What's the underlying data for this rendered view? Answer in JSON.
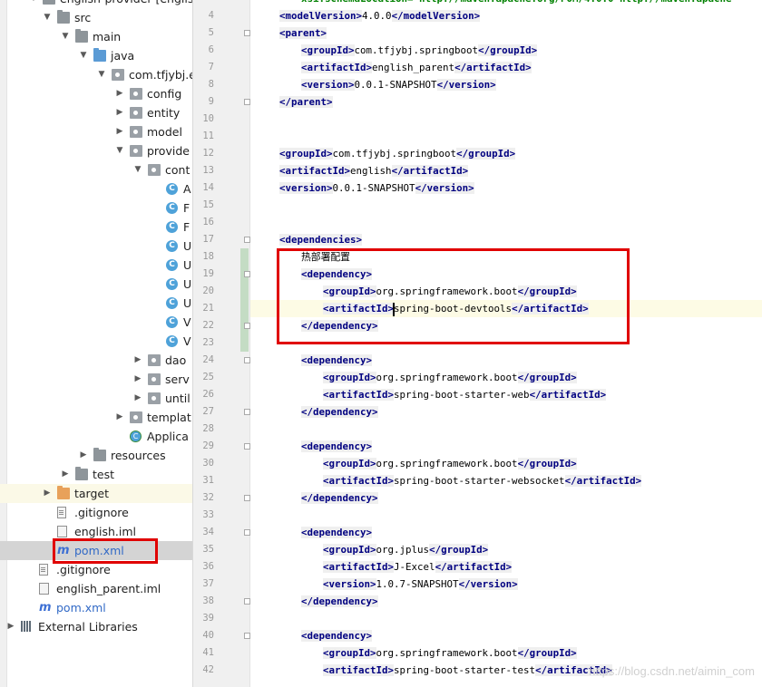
{
  "tree": {
    "project_label": "english-provider [english",
    "items": [
      {
        "label": "src",
        "depth": 1,
        "arrow": "down",
        "icon": "folder-gray"
      },
      {
        "label": "main",
        "depth": 2,
        "arrow": "down",
        "icon": "folder-gray"
      },
      {
        "label": "java",
        "depth": 3,
        "arrow": "down",
        "icon": "folder-blue"
      },
      {
        "label": "com.tfjybj.e",
        "depth": 4,
        "arrow": "down",
        "icon": "package"
      },
      {
        "label": "config",
        "depth": 5,
        "arrow": "right",
        "icon": "package"
      },
      {
        "label": "entity",
        "depth": 5,
        "arrow": "right",
        "icon": "package"
      },
      {
        "label": "model",
        "depth": 5,
        "arrow": "right",
        "icon": "package"
      },
      {
        "label": "provide",
        "depth": 5,
        "arrow": "down",
        "icon": "package"
      },
      {
        "label": "cont",
        "depth": 6,
        "arrow": "down",
        "icon": "package"
      },
      {
        "label": "A",
        "depth": 7,
        "arrow": "",
        "icon": "class"
      },
      {
        "label": "F",
        "depth": 7,
        "arrow": "",
        "icon": "class"
      },
      {
        "label": "F",
        "depth": 7,
        "arrow": "",
        "icon": "class"
      },
      {
        "label": "U",
        "depth": 7,
        "arrow": "",
        "icon": "class"
      },
      {
        "label": "U",
        "depth": 7,
        "arrow": "",
        "icon": "class"
      },
      {
        "label": "U",
        "depth": 7,
        "arrow": "",
        "icon": "class"
      },
      {
        "label": "U",
        "depth": 7,
        "arrow": "",
        "icon": "class"
      },
      {
        "label": "V",
        "depth": 7,
        "arrow": "",
        "icon": "class"
      },
      {
        "label": "V",
        "depth": 7,
        "arrow": "",
        "icon": "class"
      },
      {
        "label": "dao",
        "depth": 6,
        "arrow": "right",
        "icon": "package"
      },
      {
        "label": "serv",
        "depth": 6,
        "arrow": "right",
        "icon": "package"
      },
      {
        "label": "until",
        "depth": 6,
        "arrow": "right",
        "icon": "package"
      },
      {
        "label": "templat",
        "depth": 5,
        "arrow": "right",
        "icon": "package"
      },
      {
        "label": "Applica",
        "depth": 5,
        "arrow": "",
        "icon": "app"
      },
      {
        "label": "resources",
        "depth": 3,
        "arrow": "right",
        "icon": "folder-res"
      },
      {
        "label": "test",
        "depth": 2,
        "arrow": "right",
        "icon": "folder-gray"
      },
      {
        "label": "target",
        "depth": 1,
        "arrow": "right",
        "icon": "folder-orange"
      },
      {
        "label": ".gitignore",
        "depth": 1,
        "arrow": "",
        "icon": "file"
      },
      {
        "label": "english.iml",
        "depth": 1,
        "arrow": "",
        "icon": "iml"
      },
      {
        "label": "pom.xml",
        "depth": 1,
        "arrow": "",
        "icon": "maven"
      },
      {
        "label": ".gitignore",
        "depth": 0,
        "arrow": "",
        "icon": "file"
      },
      {
        "label": "english_parent.iml",
        "depth": 0,
        "arrow": "",
        "icon": "iml"
      },
      {
        "label": "pom.xml",
        "depth": 0,
        "arrow": "",
        "icon": "maven"
      },
      {
        "label": "External Libraries",
        "depth": -1,
        "arrow": "right",
        "icon": "libraries"
      }
    ]
  },
  "editor": {
    "line_numbers": [
      "4",
      "5",
      "6",
      "7",
      "8",
      "9",
      "10",
      "11",
      "12",
      "13",
      "14",
      "15",
      "16",
      "17",
      "18",
      "19",
      "20",
      "21",
      "22",
      "23",
      "24",
      "25",
      "26",
      "27",
      "28",
      "29",
      "30",
      "31",
      "32",
      "33",
      "34",
      "35",
      "36",
      "37",
      "38",
      "39",
      "40",
      "41",
      "42"
    ],
    "top_partial": "xsi:schemaLocation=\"http://maven.apache.org/POM/4.0.0 http://maven.apache",
    "lines": [
      {
        "n": "4",
        "indent": 0,
        "open": "modelVersion",
        "text": "4.0.0",
        "close": "modelVersion"
      },
      {
        "n": "5",
        "indent": 0,
        "open": "parent"
      },
      {
        "n": "6",
        "indent": 1,
        "open": "groupId",
        "text": "com.tfjybj.springboot",
        "close": "groupId"
      },
      {
        "n": "7",
        "indent": 1,
        "open": "artifactId",
        "text": "english_parent",
        "close": "artifactId"
      },
      {
        "n": "8",
        "indent": 1,
        "open": "version",
        "text": "0.0.1-SNAPSHOT",
        "close": "version"
      },
      {
        "n": "9",
        "indent": 0,
        "close": "parent"
      },
      {
        "n": "10"
      },
      {
        "n": "11"
      },
      {
        "n": "12",
        "indent": 0,
        "open": "groupId",
        "text": "com.tfjybj.springboot",
        "close": "groupId"
      },
      {
        "n": "13",
        "indent": 0,
        "open": "artifactId",
        "text": "english",
        "close": "artifactId"
      },
      {
        "n": "14",
        "indent": 0,
        "open": "version",
        "text": "0.0.1-SNAPSHOT",
        "close": "version"
      },
      {
        "n": "15"
      },
      {
        "n": "16"
      },
      {
        "n": "17",
        "indent": 0,
        "open": "dependencies"
      },
      {
        "n": "18",
        "indent": 1,
        "plain": "热部署配置"
      },
      {
        "n": "19",
        "indent": 1,
        "open": "dependency"
      },
      {
        "n": "20",
        "indent": 2,
        "open": "groupId",
        "text": "org.springframework.boot",
        "close": "groupId"
      },
      {
        "n": "21",
        "indent": 2,
        "open": "artifactId",
        "text": "spring-boot-devtools",
        "close": "artifactId",
        "caret": true
      },
      {
        "n": "22",
        "indent": 1,
        "close": "dependency"
      },
      {
        "n": "23"
      },
      {
        "n": "24",
        "indent": 1,
        "open": "dependency"
      },
      {
        "n": "25",
        "indent": 2,
        "open": "groupId",
        "text": "org.springframework.boot",
        "close": "groupId"
      },
      {
        "n": "26",
        "indent": 2,
        "open": "artifactId",
        "text": "spring-boot-starter-web",
        "close": "artifactId"
      },
      {
        "n": "27",
        "indent": 1,
        "close": "dependency"
      },
      {
        "n": "28"
      },
      {
        "n": "29",
        "indent": 1,
        "open": "dependency"
      },
      {
        "n": "30",
        "indent": 2,
        "open": "groupId",
        "text": "org.springframework.boot",
        "close": "groupId"
      },
      {
        "n": "31",
        "indent": 2,
        "open": "artifactId",
        "text": "spring-boot-starter-websocket",
        "close": "artifactId"
      },
      {
        "n": "32",
        "indent": 1,
        "close": "dependency"
      },
      {
        "n": "33"
      },
      {
        "n": "34",
        "indent": 1,
        "open": "dependency"
      },
      {
        "n": "35",
        "indent": 2,
        "open": "groupId",
        "text": "org.jplus",
        "close": "groupId"
      },
      {
        "n": "36",
        "indent": 2,
        "open": "artifactId",
        "text": "J-Excel",
        "close": "artifactId"
      },
      {
        "n": "37",
        "indent": 2,
        "open": "version",
        "text": "1.0.7-SNAPSHOT",
        "close": "version"
      },
      {
        "n": "38",
        "indent": 1,
        "close": "dependency"
      },
      {
        "n": "39"
      },
      {
        "n": "40",
        "indent": 1,
        "open": "dependency"
      },
      {
        "n": "41",
        "indent": 2,
        "open": "groupId",
        "text": "org.springframework.boot",
        "close": "groupId"
      },
      {
        "n": "42",
        "indent": 2,
        "open": "artifactId",
        "text": "spring-boot-starter-test",
        "close": "artifactId"
      }
    ]
  },
  "watermark": "https://blog.csdn.net/aimin_com",
  "colors": {
    "annotation_red": "#e00000",
    "xml_tag": "#000080",
    "current_line": "#fdfbe5",
    "selection": "#d4d4d4"
  }
}
